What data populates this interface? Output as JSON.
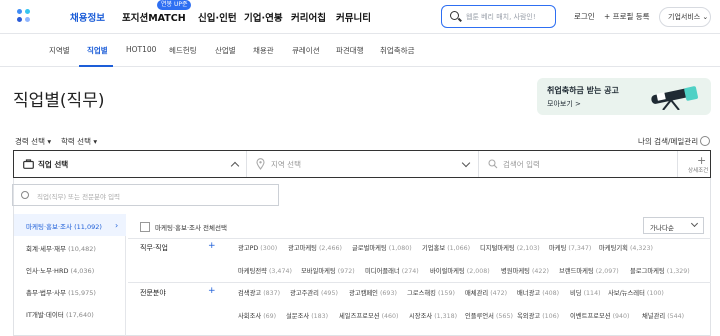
{
  "header": {
    "nav": [
      "채용정보",
      "포지션MATCH",
      "신입·인턴",
      "기업·연봉",
      "커리어칩",
      "커뮤니티"
    ],
    "match_badge": "연봉 UP준",
    "search_placeholder": "웹툰 베리 매치, 사람인!",
    "login": "로그인",
    "profile": "+ 프로필 등록",
    "corp_service": "기업서비스 ⌄"
  },
  "subnav": {
    "tabs": [
      "지역별",
      "직업별",
      "HOT100",
      "헤드헌팅",
      "산업별",
      "채용관",
      "큐레이션",
      "파견대행",
      "취업축하금"
    ],
    "active": "직업별"
  },
  "page": {
    "title": "직업별(직무)",
    "banner_title": "취업축하금 받는 공고",
    "banner_link": "모아보기 >"
  },
  "filters": {
    "career": "경력 선택 ▾",
    "education": "학력 선택 ▾",
    "my_search": "나의 검색/메일관리",
    "job_select": "직업 선택",
    "region_select": "지역 선택",
    "keyword_placeholder": "검색어 입력",
    "detail": "상세조건"
  },
  "panel": {
    "search_placeholder": "직업(직무) 또는 전문분야 입력",
    "categories": [
      {
        "name": "마케팅·홍보·조사",
        "count": "(11,092)"
      },
      {
        "name": "회계·세무·재무",
        "count": "(10,482)"
      },
      {
        "name": "인사·노무·HRD",
        "count": "(4,036)"
      },
      {
        "name": "총무·법무·사무",
        "count": "(15,975)"
      },
      {
        "name": "IT개발·데이터",
        "count": "(17,640)"
      }
    ],
    "all_label": "마케팅·홍보·조사 전체선택",
    "sort": "가나다순",
    "group1": "직무·직업",
    "group2": "전문분야",
    "rows": [
      [
        {
          "name": "광고PD",
          "count": "(300)"
        },
        {
          "name": "광고마케팅",
          "count": "(2,466)"
        },
        {
          "name": "글로벌마케팅",
          "count": "(1,080)"
        },
        {
          "name": "기업홍보",
          "count": "(1,066)"
        },
        {
          "name": "디지털마케팅",
          "count": "(2,103)"
        },
        {
          "name": "마케팅",
          "count": "(7,347)"
        },
        {
          "name": "마케팅기획",
          "count": "(4,323)"
        }
      ],
      [
        {
          "name": "마케팅전략",
          "count": "(3,474)"
        },
        {
          "name": "모바일마케팅",
          "count": "(972)"
        },
        {
          "name": "미디어플래너",
          "count": "(274)"
        },
        {
          "name": "바이럴마케팅",
          "count": "(2,008)"
        },
        {
          "name": "병원마케팅",
          "count": "(422)"
        },
        {
          "name": "브랜드마케팅",
          "count": "(2,097)"
        },
        {
          "name": "블로그마케팅",
          "count": "(1,329)"
        }
      ],
      [
        {
          "name": "검색광고",
          "count": "(837)"
        },
        {
          "name": "광고주관리",
          "count": "(495)"
        },
        {
          "name": "광고캠페인",
          "count": "(693)"
        },
        {
          "name": "그로스해킹",
          "count": "(159)"
        },
        {
          "name": "매체관리",
          "count": "(472)"
        },
        {
          "name": "배너광고",
          "count": "(408)"
        },
        {
          "name": "비딩",
          "count": "(114)"
        },
        {
          "name": "사보/뉴스레터",
          "count": "(100)"
        }
      ],
      [
        {
          "name": "사회조사",
          "count": "(69)"
        },
        {
          "name": "설문조사",
          "count": "(183)"
        },
        {
          "name": "세일즈프로모션",
          "count": "(460)"
        },
        {
          "name": "시장조사",
          "count": "(1,318)"
        },
        {
          "name": "인플루언서",
          "count": "(565)"
        },
        {
          "name": "옥외광고",
          "count": "(106)"
        },
        {
          "name": "이벤트프로모션",
          "count": "(940)"
        },
        {
          "name": "채널관리",
          "count": "(544)"
        }
      ]
    ]
  }
}
